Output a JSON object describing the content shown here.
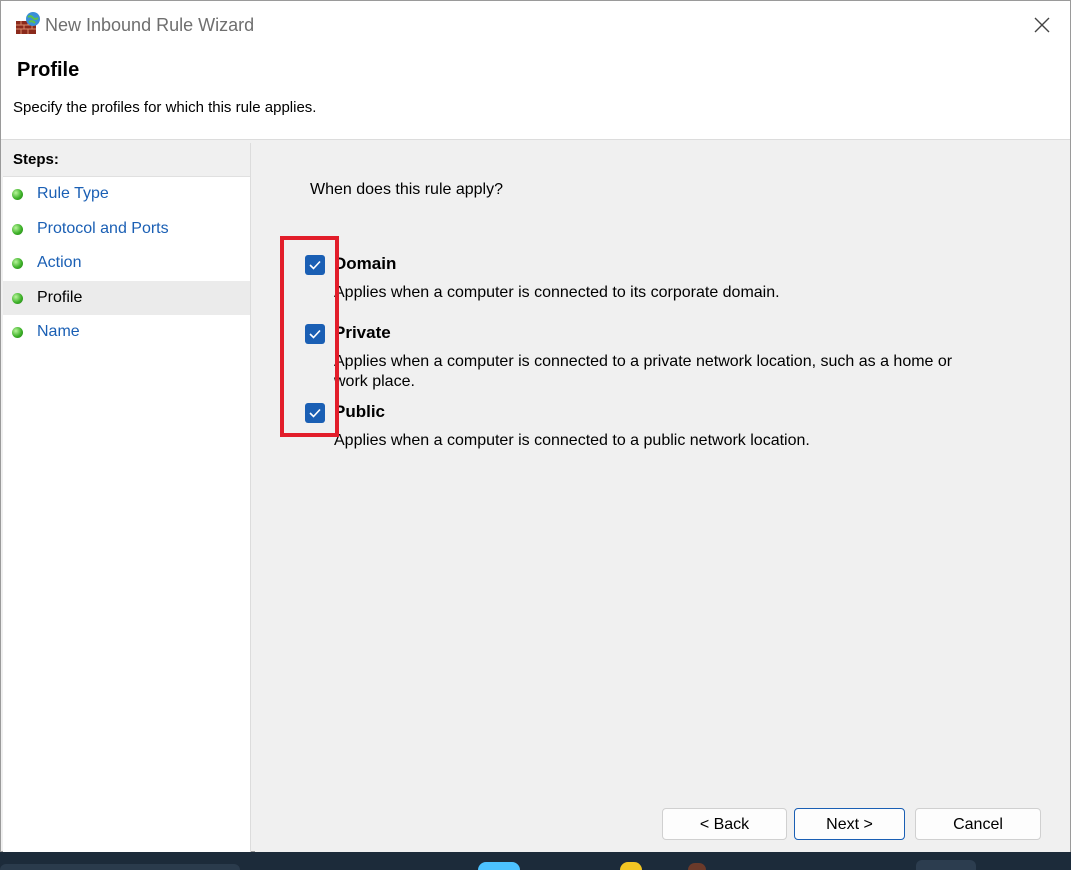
{
  "window": {
    "title": "New Inbound Rule Wizard"
  },
  "header": {
    "title": "Profile",
    "subtitle": "Specify the profiles for which this rule applies."
  },
  "steps": {
    "title": "Steps:",
    "items": [
      {
        "label": "Rule Type",
        "current": false
      },
      {
        "label": "Protocol and Ports",
        "current": false
      },
      {
        "label": "Action",
        "current": false
      },
      {
        "label": "Profile",
        "current": true
      },
      {
        "label": "Name",
        "current": false
      }
    ]
  },
  "content": {
    "question": "When does this rule apply?",
    "options": [
      {
        "label": "Domain",
        "checked": true,
        "description": "Applies when a computer is connected to its corporate domain."
      },
      {
        "label": "Private",
        "checked": true,
        "description": "Applies when a computer is connected to a private network location, such as a home or work place."
      },
      {
        "label": "Public",
        "checked": true,
        "description": "Applies when a computer is connected to a public network location."
      }
    ]
  },
  "buttons": {
    "back": "< Back",
    "next": "Next >",
    "cancel": "Cancel"
  },
  "colors": {
    "accent": "#1a5fb4",
    "highlight": "#e21d2a",
    "step_dot": "#3fb22a"
  }
}
